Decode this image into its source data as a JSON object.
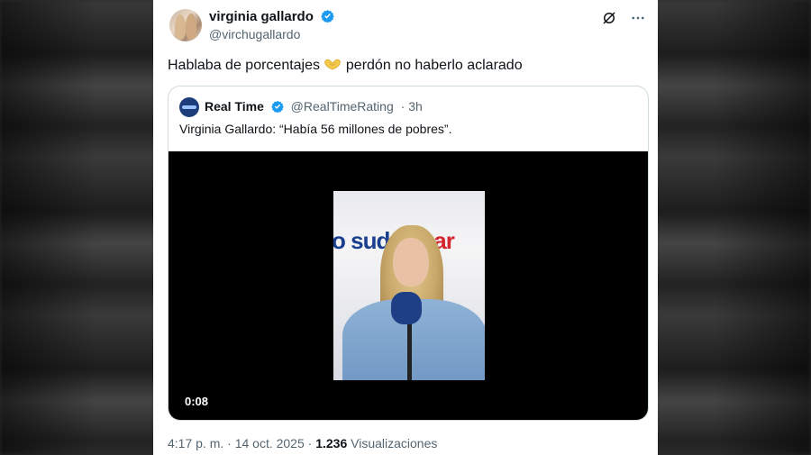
{
  "tweet": {
    "author_name": "virginia gallardo",
    "author_handle": "@virchugallardo",
    "text_before_emoji": "Hablaba de porcentajes ",
    "text_after_emoji": " perdón no haberlo aclarado",
    "emoji": "heart-hands-icon"
  },
  "quoted": {
    "author_name": "Real Time",
    "author_handle": "@RealTimeRating",
    "age": "· 3h",
    "text": "Virginia Gallardo: “Había 56 millones de pobres”.",
    "video": {
      "duration": "0:08",
      "studio_text_left": "o suda",
      "studio_text_right": "car"
    }
  },
  "meta": {
    "time_date": "4:17 p. m. · 14 oct. 2025 · ",
    "views_count": "1.236",
    "views_label": " Visualizaciones"
  },
  "colors": {
    "verified": "#1d9bf0",
    "text_primary": "#0f1419",
    "text_secondary": "#536471",
    "border": "#cfd9de"
  }
}
